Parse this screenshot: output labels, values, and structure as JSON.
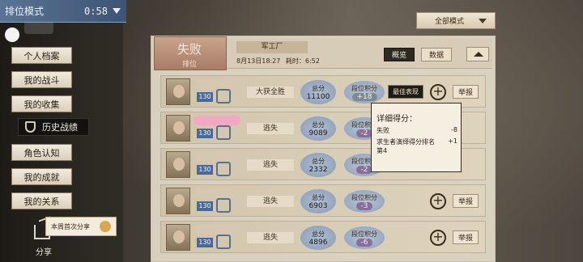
{
  "topbar": {
    "mode": "排位模式",
    "timer": "0:58"
  },
  "sidebar": {
    "items": [
      {
        "label": "个人档案"
      },
      {
        "label": "我的战斗"
      },
      {
        "label": "我的收集"
      },
      {
        "label": "历史战绩",
        "active": true
      },
      {
        "label": "角色认知"
      },
      {
        "label": "我的成就"
      },
      {
        "label": "我的关系"
      }
    ],
    "first_share": "本周首次分享",
    "share": "分享"
  },
  "filter": {
    "selected": "全部模式"
  },
  "match": {
    "result": "失败",
    "mode": "排位",
    "map": "军工厂",
    "date": "8月13日18:27",
    "duration_label": "耗时：",
    "duration": "6:52",
    "tabs": [
      "概览",
      "数据"
    ]
  },
  "players": [
    {
      "level": "130",
      "role": "大获全胜",
      "score_label": "总分",
      "score": "11100",
      "rank_label": "段位积分",
      "rank": "+18",
      "badge": "最佳表现",
      "report": "举报",
      "name_style": "plain"
    },
    {
      "level": "130",
      "role": "逃失",
      "score_label": "总分",
      "score": "9089",
      "rank_label": "段位积分",
      "rank": "-2",
      "report": "",
      "name_style": "pink"
    },
    {
      "level": "130",
      "role": "逃失",
      "score_label": "总分",
      "score": "2332",
      "rank_label": "段位积分",
      "rank": "-2",
      "report": "",
      "name_style": "plain"
    },
    {
      "level": "130",
      "role": "逃失",
      "score_label": "总分",
      "score": "6903",
      "rank_label": "段位积分",
      "rank": "-3",
      "report": "举报",
      "name_style": "plain"
    },
    {
      "level": "130",
      "role": "逃失",
      "score_label": "总分",
      "score": "4896",
      "rank_label": "段位积分",
      "rank": "-6",
      "report": "举报",
      "name_style": "plain"
    }
  ],
  "tooltip": {
    "title": "详细得分：",
    "rows": [
      {
        "label": "失败",
        "value": "-8"
      },
      {
        "label": "求生者演绎得分排名第4",
        "value": "+1"
      }
    ]
  },
  "colors": {
    "accent_blue": "#466b9a",
    "panel": "#e4dccb",
    "loss_badge": "#a97c66"
  }
}
